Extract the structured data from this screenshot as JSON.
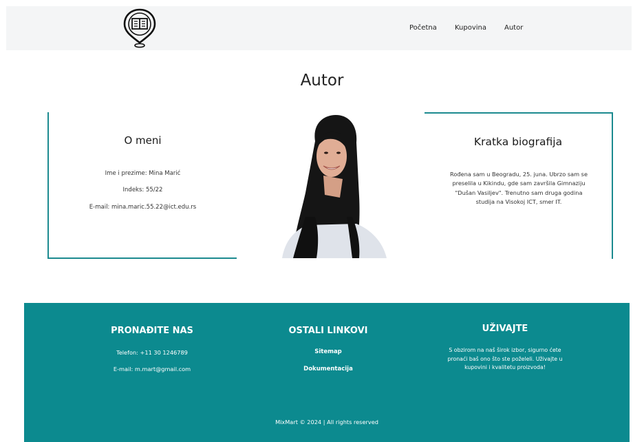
{
  "nav": {
    "logo": "book-location-logo",
    "items": [
      "Početna",
      "Kupovina",
      "Autor"
    ]
  },
  "page_title": "Autor",
  "about": {
    "heading": "O meni",
    "name_line": "Ime i prezime: Mina Marić",
    "index_line": "Indeks: 55/22",
    "email_line": "E-mail: mina.maric.55.22@ict.edu.rs"
  },
  "bio": {
    "heading": "Kratka biografija",
    "text": "Rođena sam u Beogradu, 25. juna. Ubrzo sam se preselila u Kikindu, gde sam završila Gimnaziju \"Dušan Vasiljev\". Trenutno sam druga godina studija na Visokoj ICT, smer IT."
  },
  "footer": {
    "find_us": {
      "heading": "PRONAĐITE NAS",
      "phone": "Telefon: +11 30 1246789",
      "email": "E-mail: m.mart@gmail.com"
    },
    "other_links": {
      "heading": "OSTALI LINKOVI",
      "links": [
        "Sitemap",
        "Dokumentacija"
      ]
    },
    "enjoy": {
      "heading": "UŽIVAJTE",
      "text": "S obzirom na naš širok izbor, sigurno ćete pronaći baš ono što ste poželeli. Uživajte u kupovini i kvalitetu proizvoda!"
    },
    "copyright": "MixMart © 2024 | All rights reserved"
  },
  "colors": {
    "accent": "#1b8a8f",
    "footer_bg": "#0c8a8f",
    "header_bg": "#f4f5f6"
  }
}
